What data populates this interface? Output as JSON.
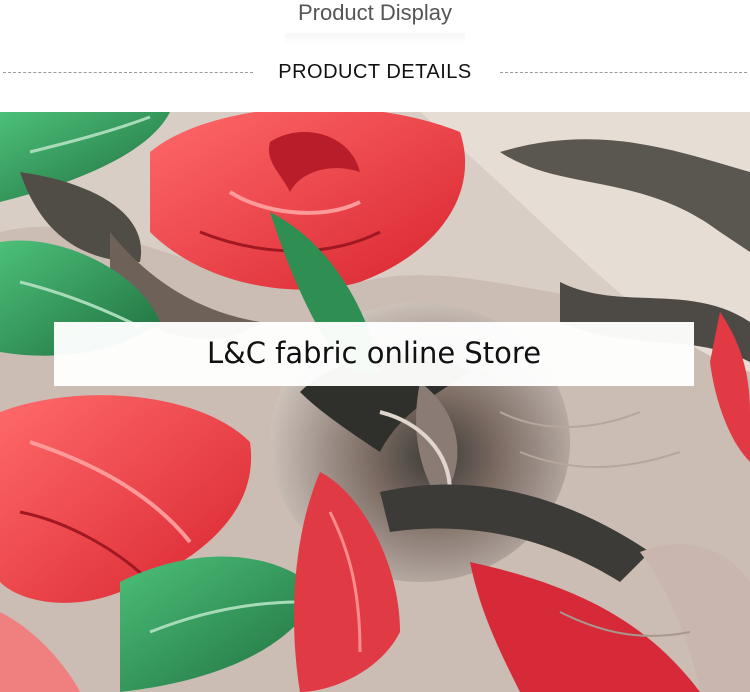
{
  "header": {
    "display_title": "Product Display",
    "details_title": "PRODUCT DETAILS"
  },
  "banner": {
    "text": "L&C fabric online Store"
  },
  "colors": {
    "rose_red": "#e8343f",
    "leaf_green": "#2e9a55",
    "dark_gray": "#4a4a44",
    "cream": "#e8e0d8",
    "taupe": "#9c8378"
  }
}
